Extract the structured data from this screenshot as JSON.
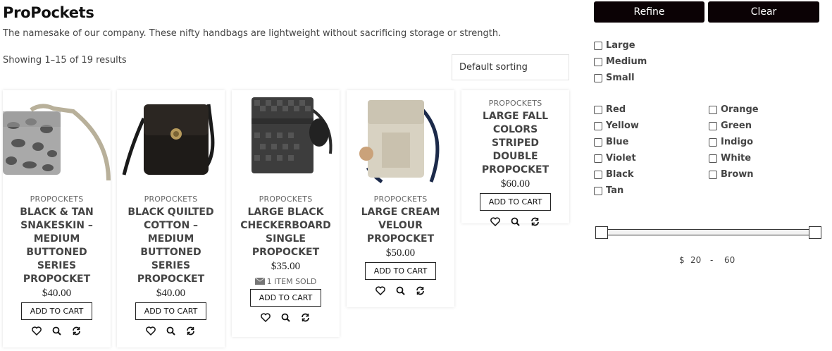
{
  "page": {
    "title": "ProPockets",
    "description": "The namesake of our company. These nifty handbags are lightweight without sacrificing storage or strength.",
    "result_count": "Showing 1–15 of 19 results",
    "sorting": "Default sorting"
  },
  "products": [
    {
      "category": "PROPOCKETS",
      "name": "BLACK & TAN SNAKESKIN – MEDIUM BUTTONED SERIES PROPOCKET",
      "price": "$40.00",
      "cart_label": "ADD TO CART"
    },
    {
      "category": "PROPOCKETS",
      "name": "BLACK QUILTED COTTON – MEDIUM BUTTONED SERIES PROPOCKET",
      "price": "$40.00",
      "cart_label": "ADD TO CART"
    },
    {
      "category": "PROPOCKETS",
      "name": "LARGE BLACK CHECKERBOARD SINGLE PROPOCKET",
      "price": "$35.00",
      "sold": "1 ITEM SOLD",
      "cart_label": "ADD TO CART"
    },
    {
      "category": "PROPOCKETS",
      "name": "LARGE CREAM VELOUR PROPOCKET",
      "price": "$50.00",
      "cart_label": "ADD TO CART"
    },
    {
      "category": "PROPOCKETS",
      "name": "LARGE FALL COLORS STRIPED DOUBLE PROPOCKET",
      "price": "$60.00",
      "cart_label": "ADD TO CART"
    }
  ],
  "product_icons": [
    "heart-icon",
    "search-icon",
    "refresh-icon"
  ],
  "filters": {
    "refine_label": "Refine",
    "clear_label": "Clear",
    "sizes": [
      "Large",
      "Medium",
      "Small"
    ],
    "colors_left": [
      "Red",
      "Yellow",
      "Blue",
      "Violet",
      "Black",
      "Tan"
    ],
    "colors_right": [
      "Orange",
      "Green",
      "Indigo",
      "White",
      "Brown"
    ],
    "price": {
      "currency": "$",
      "min": "20",
      "sep": "-",
      "max": "60"
    }
  },
  "colors": {
    "button_bg": "#0b0205",
    "accent": "#111111"
  }
}
